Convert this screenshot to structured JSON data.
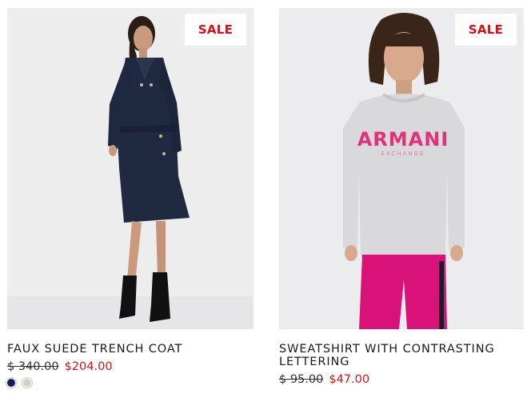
{
  "products": [
    {
      "badge": "SALE",
      "title": "FAUX SUEDE TRENCH COAT",
      "price_original": "$ 340.00",
      "price_sale": "$204.00",
      "swatches": [
        {
          "color": "#141c5e"
        },
        {
          "color": "#d9cfbd"
        }
      ]
    },
    {
      "badge": "SALE",
      "title": "SWEATSHIRT WITH CONTRASTING LETTERING",
      "price_original": "$ 95.00",
      "price_sale": "$47.00",
      "print_text": "ARMANI",
      "print_subtext": "EXCHANGE"
    }
  ],
  "colors": {
    "sale_red": "#d3131a",
    "coat_navy": "#1f2940",
    "sweatshirt_grey": "#d9d9db",
    "leggings_pink": "#d9127a"
  }
}
